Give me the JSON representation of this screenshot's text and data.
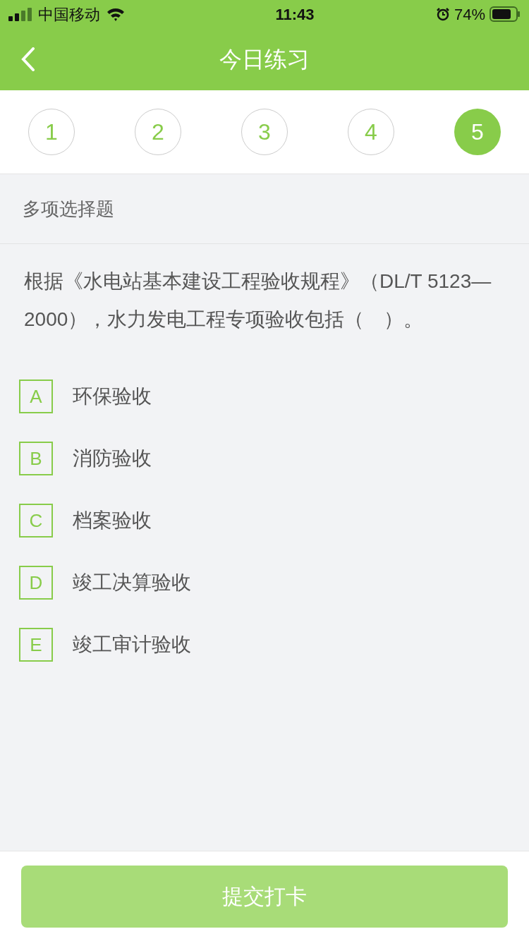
{
  "status_bar": {
    "carrier": "中国移动",
    "time": "11:43",
    "battery": "74%"
  },
  "nav": {
    "title": "今日练习"
  },
  "steps": [
    {
      "label": "1",
      "selected": false
    },
    {
      "label": "2",
      "selected": false
    },
    {
      "label": "3",
      "selected": false
    },
    {
      "label": "4",
      "selected": false
    },
    {
      "label": "5",
      "selected": true
    }
  ],
  "question_type": "多项选择题",
  "question": "根据《水电站基本建设工程验收规程》（DL/T 5123—2000），水力发电工程专项验收包括（　）。",
  "options": [
    {
      "letter": "A",
      "text": "环保验收",
      "selected": false
    },
    {
      "letter": "B",
      "text": "消防验收",
      "selected": false
    },
    {
      "letter": "C",
      "text": "档案验收",
      "selected": false
    },
    {
      "letter": "D",
      "text": "竣工决算验收",
      "selected": false
    },
    {
      "letter": "E",
      "text": "竣工审计验收",
      "selected": false
    }
  ],
  "submit": {
    "label": "提交打卡",
    "disabled": true
  }
}
